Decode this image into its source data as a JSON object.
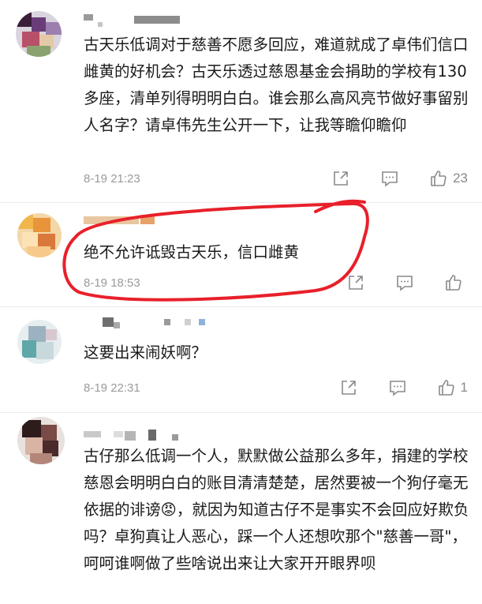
{
  "comments": [
    {
      "text": "古天乐低调对于慈善不愿多回应，难道就成了卓伟们信口雌黄的好机会？古天乐透过慈恩基金会捐助的学校有130多座，清单列得明明白白。谁会那么高风亮节做好事留别人名字？请卓伟先生公开一下，让我等瞻仰瞻仰",
      "time": "8-19 21:23",
      "likes": "23"
    },
    {
      "text": "绝不允许诋毁古天乐，信口雌黄",
      "time": "8-19 18:53",
      "likes": ""
    },
    {
      "text": "这要出来闹妖啊？",
      "time": "8-19 22:31",
      "likes": "1"
    },
    {
      "text": "古仔那么低调一个人，默默做公益那么多年，捐建的学校慈恩会明明白白的账目清清楚楚，居然要被一个狗仔毫无依据的诽谤😡，就因为知道古仔不是事实不会回应好欺负吗？卓狗真让人恶心，踩一个人还想吹那个\"慈善一哥\"，呵呵谁啊做了些啥说出来让大家开开眼界呗",
      "time": "",
      "likes": ""
    }
  ],
  "icons": {
    "share": "share-icon",
    "comment": "comment-icon",
    "like": "like-icon"
  },
  "colors": {
    "annotation": "#e8202a",
    "meta": "#9a9a9a"
  }
}
